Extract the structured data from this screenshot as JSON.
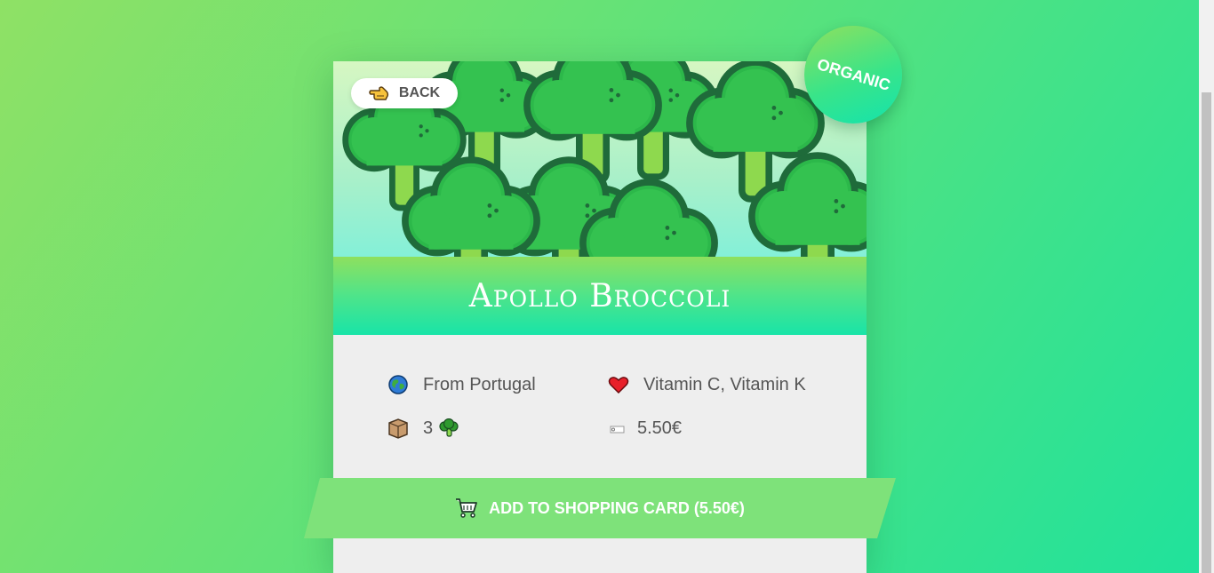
{
  "product": {
    "name": "Apollo Broccoli",
    "badge": "ORGANIC",
    "origin": "From Portugal",
    "vitamins": "Vitamin C, Vitamin K",
    "quantity": "3",
    "price": "5.50€"
  },
  "navigation": {
    "back_label": "BACK"
  },
  "actions": {
    "add_to_cart_label": "ADD TO SHOPPING CARD (5.50€)"
  },
  "icons": {
    "back": "pointing-hand-icon",
    "origin": "globe-icon",
    "vitamins": "heart-icon",
    "quantity": "box-icon",
    "quantity_unit": "broccoli-icon",
    "price": "price-tag-icon",
    "cart": "shopping-cart-icon"
  },
  "colors": {
    "accent": "#7ee27a",
    "badge_start": "#8ee05e",
    "badge_end": "#14e3ad",
    "text": "#555555",
    "card_bg": "#eeeeee"
  }
}
